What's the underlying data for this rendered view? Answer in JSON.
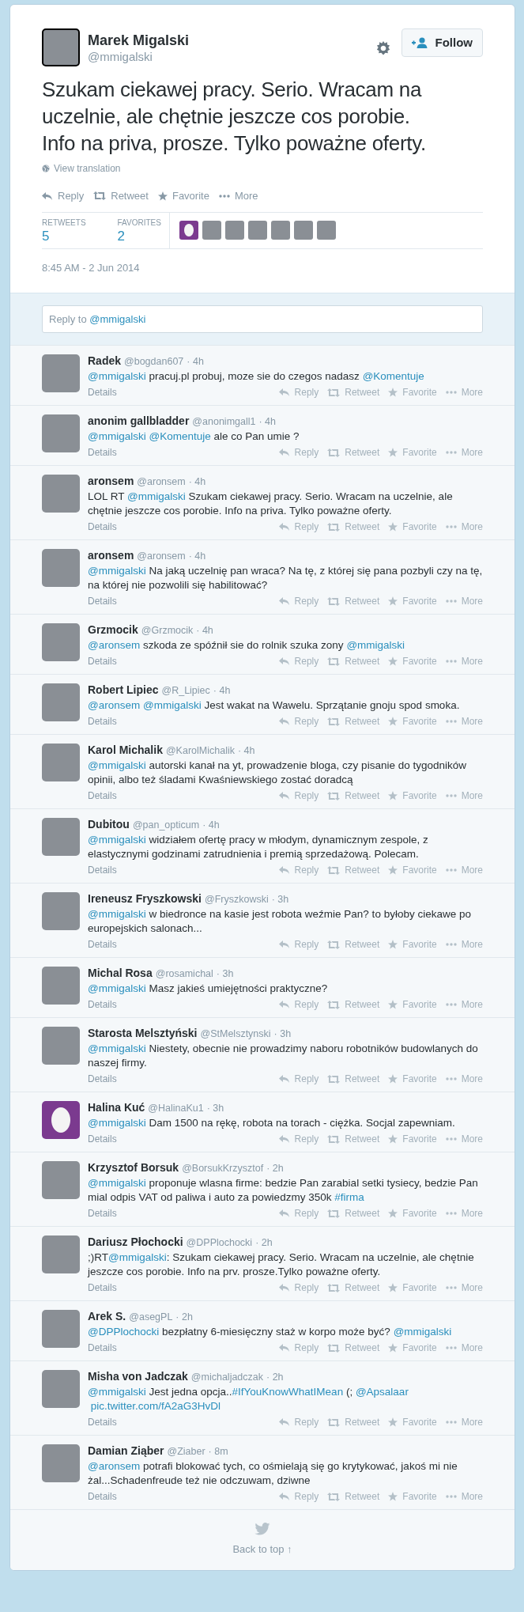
{
  "tweet": {
    "author": {
      "name": "Marek Migalski",
      "handle": "@mmigalski"
    },
    "follow_button": "Follow",
    "text": "Szukam ciekawej pracy. Serio. Wracam na uczelnie, ale chętnie jeszcze cos porobie. Info na priva, prosze. Tylko poważne oferty.",
    "translation_link": "View translation",
    "actions": [
      {
        "kind": "reply",
        "label": "Reply"
      },
      {
        "kind": "retweet",
        "label": "Retweet"
      },
      {
        "kind": "favorite",
        "label": "Favorite"
      },
      {
        "kind": "more",
        "label": "More"
      }
    ],
    "stats": [
      {
        "label": "RETWEETS",
        "value": "5"
      },
      {
        "label": "FAVORITES",
        "value": "2"
      }
    ],
    "favoriters": [
      {
        "default_avatar": true
      },
      {
        "default_avatar": false
      },
      {
        "default_avatar": false
      },
      {
        "default_avatar": false
      },
      {
        "default_avatar": false
      },
      {
        "default_avatar": false
      },
      {
        "default_avatar": false
      }
    ],
    "timestamp": "8:45 AM - 2 Jun 2014"
  },
  "reply_box": {
    "placeholder_parts": [
      {
        "kind": "plain",
        "text": "Reply to "
      },
      {
        "kind": "link",
        "text": "@mmigalski"
      }
    ]
  },
  "replies": [
    {
      "name": "Radek",
      "handle": "@bogdan607",
      "time": "· 4h",
      "default_avatar": false,
      "parts": [
        {
          "kind": "link",
          "text": "@mmigalski"
        },
        {
          "kind": "plain",
          "text": " pracuj.pl probuj, moze sie do czegos nadasz "
        },
        {
          "kind": "link",
          "text": "@Komentuje"
        }
      ],
      "details": "Details",
      "actions": [
        {
          "kind": "reply",
          "label": "Reply"
        },
        {
          "kind": "retweet",
          "label": "Retweet"
        },
        {
          "kind": "favorite",
          "label": "Favorite"
        },
        {
          "kind": "more",
          "label": "More"
        }
      ]
    },
    {
      "name": "anonim gallbladder",
      "handle": "@anonimgall1",
      "time": "· 4h",
      "default_avatar": false,
      "parts": [
        {
          "kind": "link",
          "text": "@mmigalski"
        },
        {
          "kind": "link",
          "text": "@Komentuje"
        },
        {
          "kind": "plain",
          "text": " ale co Pan umie ?"
        }
      ],
      "details": "Details",
      "actions": [
        {
          "kind": "reply",
          "label": "Reply"
        },
        {
          "kind": "retweet",
          "label": "Retweet"
        },
        {
          "kind": "favorite",
          "label": "Favorite"
        },
        {
          "kind": "more",
          "label": "More"
        }
      ]
    },
    {
      "name": "aronsem",
      "handle": "@aronsem",
      "time": "· 4h",
      "default_avatar": false,
      "parts": [
        {
          "kind": "plain",
          "text": "LOL RT "
        },
        {
          "kind": "link",
          "text": "@mmigalski"
        },
        {
          "kind": "plain",
          "text": " Szukam ciekawej pracy. Serio. Wracam na uczelnie, ale chętnie jeszcze cos porobie. Info na priva. Tylko poważne oferty."
        }
      ],
      "details": "Details",
      "actions": [
        {
          "kind": "reply",
          "label": "Reply"
        },
        {
          "kind": "retweet",
          "label": "Retweet"
        },
        {
          "kind": "favorite",
          "label": "Favorite"
        },
        {
          "kind": "more",
          "label": "More"
        }
      ]
    },
    {
      "name": "aronsem",
      "handle": "@aronsem",
      "time": "· 4h",
      "default_avatar": false,
      "parts": [
        {
          "kind": "link",
          "text": "@mmigalski"
        },
        {
          "kind": "plain",
          "text": " Na jaką uczelnię pan wraca? Na tę, z której się pana pozbyli czy na tę, na której nie pozwolili się habilitować?"
        }
      ],
      "details": "Details",
      "actions": [
        {
          "kind": "reply",
          "label": "Reply"
        },
        {
          "kind": "retweet",
          "label": "Retweet"
        },
        {
          "kind": "favorite",
          "label": "Favorite"
        },
        {
          "kind": "more",
          "label": "More"
        }
      ]
    },
    {
      "name": "Grzmocik",
      "handle": "@Grzmocik",
      "time": "· 4h",
      "default_avatar": false,
      "parts": [
        {
          "kind": "link",
          "text": "@aronsem"
        },
        {
          "kind": "plain",
          "text": " szkoda ze spóźnił sie do rolnik szuka zony "
        },
        {
          "kind": "link",
          "text": "@mmigalski"
        }
      ],
      "details": "Details",
      "actions": [
        {
          "kind": "reply",
          "label": "Reply"
        },
        {
          "kind": "retweet",
          "label": "Retweet"
        },
        {
          "kind": "favorite",
          "label": "Favorite"
        },
        {
          "kind": "more",
          "label": "More"
        }
      ]
    },
    {
      "name": "Robert Lipiec",
      "handle": "@R_Lipiec",
      "time": "· 4h",
      "default_avatar": false,
      "parts": [
        {
          "kind": "link",
          "text": "@aronsem"
        },
        {
          "kind": "link",
          "text": "@mmigalski"
        },
        {
          "kind": "plain",
          "text": " Jest wakat na Wawelu. Sprzątanie gnoju spod smoka."
        }
      ],
      "details": "Details",
      "actions": [
        {
          "kind": "reply",
          "label": "Reply"
        },
        {
          "kind": "retweet",
          "label": "Retweet"
        },
        {
          "kind": "favorite",
          "label": "Favorite"
        },
        {
          "kind": "more",
          "label": "More"
        }
      ]
    },
    {
      "name": "Karol Michalik",
      "handle": "@KarolMichalik",
      "time": "· 4h",
      "default_avatar": false,
      "parts": [
        {
          "kind": "link",
          "text": "@mmigalski"
        },
        {
          "kind": "plain",
          "text": " autorski kanał na yt, prowadzenie bloga, czy pisanie do tygodników opinii, albo też śladami Kwaśniewskiego zostać doradcą"
        }
      ],
      "details": "Details",
      "actions": [
        {
          "kind": "reply",
          "label": "Reply"
        },
        {
          "kind": "retweet",
          "label": "Retweet"
        },
        {
          "kind": "favorite",
          "label": "Favorite"
        },
        {
          "kind": "more",
          "label": "More"
        }
      ]
    },
    {
      "name": "Dubitou",
      "handle": "@pan_opticum",
      "time": "· 4h",
      "default_avatar": false,
      "parts": [
        {
          "kind": "link",
          "text": "@mmigalski"
        },
        {
          "kind": "plain",
          "text": " widziałem ofertę pracy w młodym, dynamicznym zespole, z elastycznymi godzinami zatrudnienia i premią sprzedażową. Polecam."
        }
      ],
      "details": "Details",
      "actions": [
        {
          "kind": "reply",
          "label": "Reply"
        },
        {
          "kind": "retweet",
          "label": "Retweet"
        },
        {
          "kind": "favorite",
          "label": "Favorite"
        },
        {
          "kind": "more",
          "label": "More"
        }
      ]
    },
    {
      "name": "Ireneusz Fryszkowski",
      "handle": "@Fryszkowski",
      "time": "· 3h",
      "default_avatar": false,
      "parts": [
        {
          "kind": "link",
          "text": "@mmigalski"
        },
        {
          "kind": "plain",
          "text": " w biedronce na kasie jest robota weźmie Pan? to byłoby ciekawe po europejskich salonach..."
        }
      ],
      "details": "Details",
      "actions": [
        {
          "kind": "reply",
          "label": "Reply"
        },
        {
          "kind": "retweet",
          "label": "Retweet"
        },
        {
          "kind": "favorite",
          "label": "Favorite"
        },
        {
          "kind": "more",
          "label": "More"
        }
      ]
    },
    {
      "name": "Michal Rosa",
      "handle": "@rosamichal",
      "time": "· 3h",
      "default_avatar": false,
      "parts": [
        {
          "kind": "link",
          "text": "@mmigalski"
        },
        {
          "kind": "plain",
          "text": " Masz jakieś umiejętności praktyczne?"
        }
      ],
      "details": "Details",
      "actions": [
        {
          "kind": "reply",
          "label": "Reply"
        },
        {
          "kind": "retweet",
          "label": "Retweet"
        },
        {
          "kind": "favorite",
          "label": "Favorite"
        },
        {
          "kind": "more",
          "label": "More"
        }
      ]
    },
    {
      "name": "Starosta Melsztyński",
      "handle": "@StMelsztynski",
      "time": "· 3h",
      "default_avatar": false,
      "parts": [
        {
          "kind": "link",
          "text": "@mmigalski"
        },
        {
          "kind": "plain",
          "text": " Niestety, obecnie nie prowadzimy naboru robotników budowlanych do naszej firmy."
        }
      ],
      "details": "Details",
      "actions": [
        {
          "kind": "reply",
          "label": "Reply"
        },
        {
          "kind": "retweet",
          "label": "Retweet"
        },
        {
          "kind": "favorite",
          "label": "Favorite"
        },
        {
          "kind": "more",
          "label": "More"
        }
      ]
    },
    {
      "name": "Halina Kuć",
      "handle": "@HalinaKu1",
      "time": "· 3h",
      "default_avatar": true,
      "parts": [
        {
          "kind": "link",
          "text": "@mmigalski"
        },
        {
          "kind": "plain",
          "text": "  Dam 1500 na rękę, robota na torach - ciężka. Socjal zapewniam."
        }
      ],
      "details": "Details",
      "actions": [
        {
          "kind": "reply",
          "label": "Reply"
        },
        {
          "kind": "retweet",
          "label": "Retweet"
        },
        {
          "kind": "favorite",
          "label": "Favorite"
        },
        {
          "kind": "more",
          "label": "More"
        }
      ]
    },
    {
      "name": "Krzysztof Borsuk",
      "handle": "@BorsukKrzysztof",
      "time": "· 2h",
      "default_avatar": false,
      "parts": [
        {
          "kind": "link",
          "text": "@mmigalski"
        },
        {
          "kind": "plain",
          "text": " proponuje wlasna firme: bedzie Pan zarabial setki tysiecy, bedzie Pan mial odpis VAT od paliwa i auto za powiedzmy 350k "
        },
        {
          "kind": "link",
          "text": "#firma"
        }
      ],
      "details": "Details",
      "actions": [
        {
          "kind": "reply",
          "label": "Reply"
        },
        {
          "kind": "retweet",
          "label": "Retweet"
        },
        {
          "kind": "favorite",
          "label": "Favorite"
        },
        {
          "kind": "more",
          "label": "More"
        }
      ]
    },
    {
      "name": "Dariusz Płochocki",
      "handle": "@DPPlochocki",
      "time": "· 2h",
      "default_avatar": false,
      "parts": [
        {
          "kind": "plain",
          "text": ";)RT"
        },
        {
          "kind": "link",
          "text": "@mmigalski"
        },
        {
          "kind": "plain",
          "text": ": Szukam ciekawej pracy. Serio. Wracam na uczelnie, ale chętnie jeszcze cos porobie. Info na prv. prosze.Tylko poważne oferty."
        }
      ],
      "details": "Details",
      "actions": [
        {
          "kind": "reply",
          "label": "Reply"
        },
        {
          "kind": "retweet",
          "label": "Retweet"
        },
        {
          "kind": "favorite",
          "label": "Favorite"
        },
        {
          "kind": "more",
          "label": "More"
        }
      ]
    },
    {
      "name": "Arek S.",
      "handle": "@asegPL",
      "time": "· 2h",
      "default_avatar": false,
      "parts": [
        {
          "kind": "link",
          "text": "@DPPlochocki"
        },
        {
          "kind": "plain",
          "text": " bezpłatny 6-miesięczny staż w korpo może być? "
        },
        {
          "kind": "link",
          "text": "@mmigalski"
        }
      ],
      "details": "Details",
      "actions": [
        {
          "kind": "reply",
          "label": "Reply"
        },
        {
          "kind": "retweet",
          "label": "Retweet"
        },
        {
          "kind": "favorite",
          "label": "Favorite"
        },
        {
          "kind": "more",
          "label": "More"
        }
      ]
    },
    {
      "name": "Misha von Jadczak",
      "handle": "@michaljadczak",
      "time": "· 2h",
      "default_avatar": false,
      "parts": [
        {
          "kind": "link",
          "text": "@mmigalski"
        },
        {
          "kind": "plain",
          "text": " Jest jedna opcja.."
        },
        {
          "kind": "link",
          "text": "#IfYouKnowWhatIMean"
        },
        {
          "kind": "plain",
          "text": " (; "
        },
        {
          "kind": "link",
          "text": "@Apsalaar"
        },
        {
          "kind": "link",
          "text": "pic.twitter.com/fA2aG3HvDl"
        }
      ],
      "details": "Details",
      "actions": [
        {
          "kind": "reply",
          "label": "Reply"
        },
        {
          "kind": "retweet",
          "label": "Retweet"
        },
        {
          "kind": "favorite",
          "label": "Favorite"
        },
        {
          "kind": "more",
          "label": "More"
        }
      ]
    },
    {
      "name": "Damian Ziąber",
      "handle": "@Ziaber",
      "time": "· 8m",
      "default_avatar": false,
      "parts": [
        {
          "kind": "link",
          "text": "@aronsem"
        },
        {
          "kind": "plain",
          "text": " potrafi blokować tych, co ośmielają się go krytykować, jakoś mi nie żal...Schadenfreude też nie odczuwam, dziwne"
        }
      ],
      "details": "Details",
      "actions": [
        {
          "kind": "reply",
          "label": "Reply"
        },
        {
          "kind": "retweet",
          "label": "Retweet"
        },
        {
          "kind": "favorite",
          "label": "Favorite"
        },
        {
          "kind": "more",
          "label": "More"
        }
      ]
    }
  ],
  "footer": {
    "back_to_top": "Back to top ↑"
  }
}
